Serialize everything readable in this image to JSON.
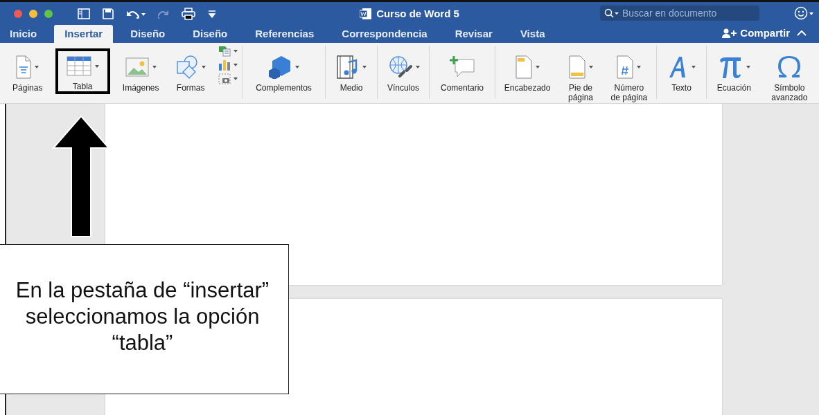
{
  "window": {
    "title": "Curso de Word 5"
  },
  "search": {
    "placeholder": "Buscar en documento"
  },
  "tabs": [
    {
      "label": "Inicio",
      "selected": false
    },
    {
      "label": "Insertar",
      "selected": true
    },
    {
      "label": "Diseño",
      "selected": false
    },
    {
      "label": "Diseño",
      "selected": false
    },
    {
      "label": "Referencias",
      "selected": false
    },
    {
      "label": "Correspondencia",
      "selected": false
    },
    {
      "label": "Revisar",
      "selected": false
    },
    {
      "label": "Vista",
      "selected": false
    }
  ],
  "share": {
    "label": "Compartir"
  },
  "ribbon": {
    "groups": [
      {
        "items": [
          {
            "kind": "pages",
            "label": "Páginas",
            "highlighted": false
          },
          {
            "kind": "table",
            "label": "Tabla",
            "highlighted": true
          },
          {
            "kind": "images",
            "label": "Imágenes",
            "highlighted": false
          },
          {
            "kind": "shapes",
            "label": "Formas",
            "highlighted": false
          },
          {
            "kind": "stack"
          }
        ]
      },
      {
        "items": [
          {
            "kind": "addins",
            "label": "Complementos",
            "highlighted": false
          }
        ]
      },
      {
        "items": [
          {
            "kind": "media",
            "label": "Medio",
            "highlighted": false
          }
        ]
      },
      {
        "items": [
          {
            "kind": "links",
            "label": "Vínculos",
            "highlighted": false
          }
        ]
      },
      {
        "items": [
          {
            "kind": "comment",
            "label": "Comentario",
            "highlighted": false
          }
        ]
      },
      {
        "items": [
          {
            "kind": "header",
            "label": "Encabezado",
            "highlighted": false
          },
          {
            "kind": "footer",
            "label": "Pie de\npágina",
            "highlighted": false
          },
          {
            "kind": "pagenum",
            "label": "Número\nde página",
            "highlighted": false
          }
        ]
      },
      {
        "items": [
          {
            "kind": "text",
            "label": "Texto",
            "highlighted": false
          }
        ]
      },
      {
        "items": [
          {
            "kind": "equation",
            "label": "Ecuación",
            "highlighted": false
          },
          {
            "kind": "symbol",
            "label": "Símbolo\navanzado",
            "highlighted": false
          }
        ]
      }
    ]
  },
  "callout": {
    "text": "En la pestaña de “insertar”\nseleccionamos la opción\n“tabla”"
  }
}
